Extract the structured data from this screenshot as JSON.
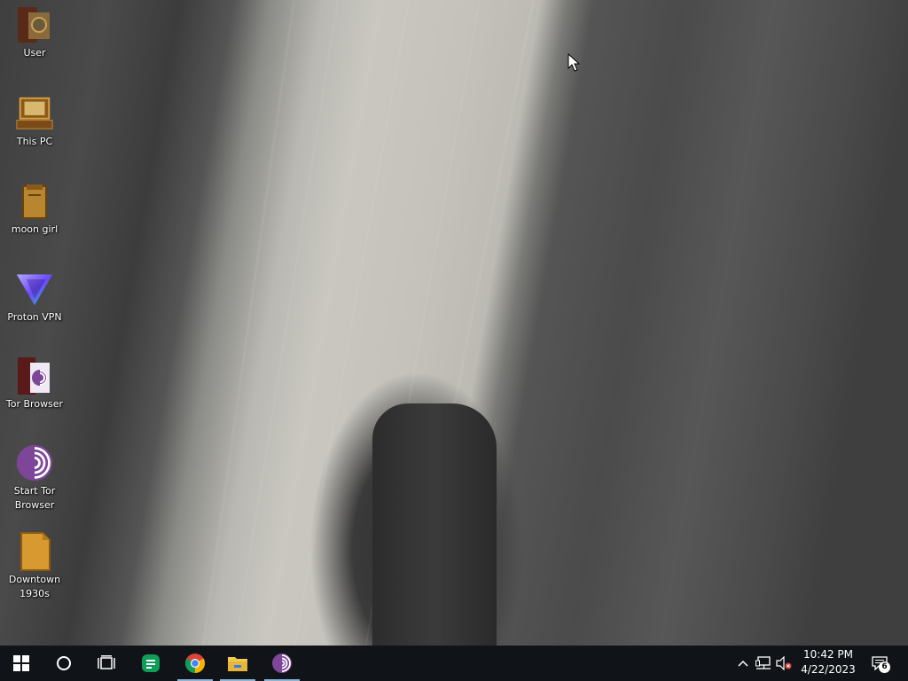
{
  "desktop": {
    "icons": [
      {
        "label": "User",
        "icon": "user-folder-icon"
      },
      {
        "label": "This PC",
        "icon": "this-pc-icon"
      },
      {
        "label": "moon girl",
        "icon": "folder-icon"
      },
      {
        "label": "Proton VPN",
        "icon": "proton-vpn-icon"
      },
      {
        "label": "Tor Browser",
        "icon": "tor-folder-icon"
      },
      {
        "label": "Start Tor Browser",
        "icon": "tor-browser-icon"
      },
      {
        "label": "Downtown 1930s",
        "icon": "document-icon"
      }
    ]
  },
  "taskbar": {
    "start": "windows-start-icon",
    "search": "search-circle-icon",
    "task_view": "task-view-icon",
    "pinned": [
      {
        "name": "sheets-app",
        "icon": "sheets-icon",
        "active": false
      },
      {
        "name": "chrome",
        "icon": "chrome-icon",
        "active": true
      },
      {
        "name": "file-explorer",
        "icon": "folder-icon",
        "active": true
      },
      {
        "name": "tor-browser",
        "icon": "tor-icon",
        "active": true
      }
    ],
    "tray": {
      "time": "10:42 PM",
      "date": "4/22/2023",
      "notification_count": "6"
    }
  },
  "colors": {
    "taskbar_bg": "#101418",
    "active_indicator": "#8ab4d8",
    "tor_purple": "#7d4698",
    "proton_purple": "#6d4aff",
    "sheets_green": "#0f9d58"
  }
}
